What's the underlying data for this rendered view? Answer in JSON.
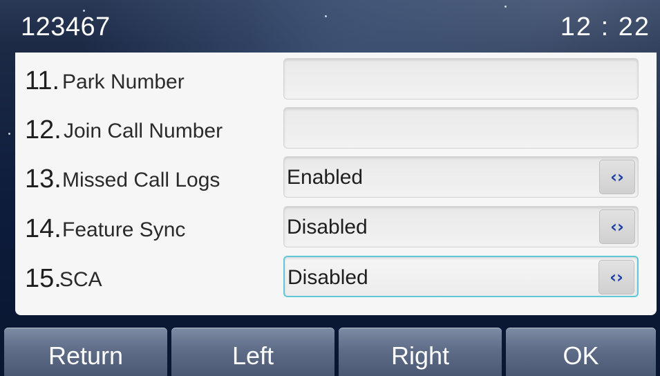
{
  "header": {
    "account": "123467",
    "time": "12 : 22"
  },
  "settings": [
    {
      "index": "11.",
      "label": "Park Number",
      "type": "text",
      "value": ""
    },
    {
      "index": "12.",
      "label": "Join Call Number",
      "type": "text",
      "value": ""
    },
    {
      "index": "13.",
      "label": "Missed Call Logs",
      "type": "select",
      "value": "Enabled",
      "icon": "left-right-arrows-icon"
    },
    {
      "index": "14.",
      "label": "Feature Sync",
      "type": "select",
      "value": "Disabled",
      "icon": "left-right-arrows-icon"
    },
    {
      "index": "15.",
      "label": "SCA",
      "type": "select",
      "value": "Disabled",
      "icon": "left-right-arrows-icon",
      "selected": true
    }
  ],
  "softkeys": [
    "Return",
    "Left",
    "Right",
    "OK"
  ],
  "colors": {
    "arrow": "#1a3fa8",
    "focus_border": "#5ec8d6",
    "softkey": "#5f6d88"
  }
}
